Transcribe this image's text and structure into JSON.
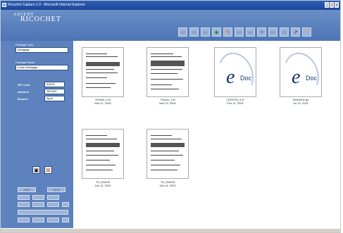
{
  "window": {
    "title": "Ricochet Capture 1.0 - Microsoft Internet Explorer"
  },
  "logo": {
    "line1": "ASCENT",
    "line2": "RICOCHET"
  },
  "toolbar": [
    "page-icon",
    "page-icon",
    "page-icon",
    "eye-icon",
    "pencil-icon",
    "page-icon",
    "page-icon",
    "delete-icon",
    "page-icon",
    "page-icon",
    "tools-icon",
    "help-icon"
  ],
  "sidebar": {
    "package_type_label": "Package Type",
    "package_type_value": "Mortgage",
    "package_name_label": "Package Name",
    "package_name_value": "Dollar Mortgage",
    "fields": [
      {
        "label": "ZIP Code:",
        "value": "92879"
      },
      {
        "label": "Amount:",
        "value": "250,000"
      },
      {
        "label": "Branch:",
        "value": "Ajuni"
      }
    ],
    "nav": [
      "|<<|<",
      ">|>>|",
      "",
      "",
      "",
      "",
      "",
      "",
      "",
      "",
      "",
      ""
    ]
  },
  "thumbnails": [
    {
      "name": "Hmtest_1.tif",
      "date": "Mar 21, 2000",
      "kind": "doc"
    },
    {
      "name": "TSpecl_1.tif",
      "date": "Mar 22, 2000",
      "kind": "doc"
    },
    {
      "name": "LESSON_4.tif",
      "date": "Feb 12, 2001",
      "kind": "edoc"
    },
    {
      "name": "flowerline.gif",
      "date": "Jul 10, 2001",
      "kind": "edoc"
    },
    {
      "name": "TS_Multi.tif",
      "date": "Jan 14, 2002",
      "kind": "doc"
    },
    {
      "name": "TS_Multi.tif",
      "date": "Jan 14, 2002",
      "kind": "doc"
    }
  ],
  "edoc": {
    "e": "e",
    "doc": "Doc"
  },
  "colors": {
    "sidebar": "#5d82be",
    "header": "#4d74b5",
    "title": "#1d4596"
  }
}
